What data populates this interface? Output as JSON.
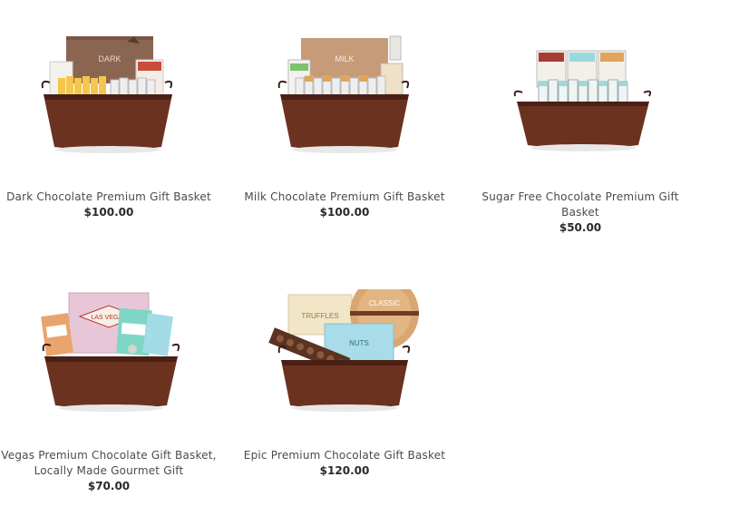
{
  "products": [
    {
      "name": "Dark Chocolate Premium Gift Basket",
      "price": "$100.00",
      "box_label": "DARK",
      "image_icon": "dark-chocolate-basket-image"
    },
    {
      "name": "Milk Chocolate Premium Gift Basket",
      "price": "$100.00",
      "box_label": "MILK",
      "image_icon": "milk-chocolate-basket-image"
    },
    {
      "name": "Sugar Free Chocolate Premium Gift Basket",
      "price": "$50.00",
      "image_icon": "sugar-free-chocolate-basket-image"
    },
    {
      "name": "Vegas Premium Chocolate Gift Basket, Locally Made Gourmet Gift",
      "price": "$70.00",
      "box_label": "LAS VEGAS",
      "image_icon": "vegas-chocolate-basket-image"
    },
    {
      "name": "Epic Premium Chocolate Gift Basket",
      "price": "$120.00",
      "box_label": "TRUFFLES",
      "box_label_2": "CLASSIC",
      "box_label_3": "NUTS",
      "image_icon": "epic-chocolate-basket-image"
    }
  ],
  "colors": {
    "basket": "#6b3220",
    "basket_dark": "#4a2014",
    "brown_box": "#8a6552",
    "tan_box": "#c79a78",
    "mint": "#9ad9dd",
    "cream": "#f1e6c8"
  }
}
